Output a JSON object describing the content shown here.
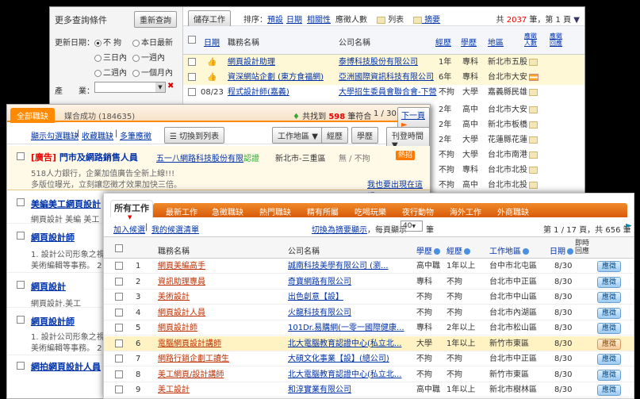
{
  "w1": {
    "side_title": "更多查詢條件",
    "reset": "重新查詢",
    "update_label": "更新日期：",
    "dates": [
      "不 拘",
      "本日最新",
      "三日內",
      "一週內",
      "二週內",
      "一個月內"
    ],
    "industry_label": "產　　業：",
    "save": "儲存工作",
    "sort_label": "排序：",
    "sorts": [
      "預設",
      "日期",
      "相關性"
    ],
    "applicants": "應徵人數",
    "view_list": "列表",
    "view_summary": "摘要",
    "total_prefix": "共",
    "total": "2037",
    "total_mid": "筆，第",
    "page": "1",
    "page_suffix": "頁",
    "cols": [
      "日期",
      "職務名稱",
      "公司名稱",
      "經歷",
      "學歷",
      "地區",
      "應徵人數",
      "應徵回應"
    ],
    "rows": [
      {
        "date": "",
        "job": "網頁設計助理",
        "company": "泰博科技股份有限公司",
        "exp": "1年",
        "edu": "專科",
        "area": "新北市五股"
      },
      {
        "date": "",
        "job": "資深網站企劃 (東方食福網)",
        "company": "亞洲國際資訊科技有限公司",
        "exp": "6年",
        "edu": "專科",
        "area": "台北市大安"
      },
      {
        "date": "08/23",
        "job": "程式設計師(嘉義)",
        "company": "大學招生委員會聯合會-下營",
        "exp": "不拘",
        "edu": "大學",
        "area": "嘉義縣民雄"
      }
    ],
    "more_rows": [
      {
        "exp": "2年",
        "edu": "高中",
        "area": "台北市大安"
      },
      {
        "exp": "2年",
        "edu": "高中",
        "area": "新北市板橋"
      },
      {
        "exp": "2年",
        "edu": "大學",
        "area": "花蓮縣花蓮"
      },
      {
        "exp": "不拘",
        "edu": "大學",
        "area": "台北市南港"
      },
      {
        "exp": "不拘",
        "edu": "專科",
        "area": "台北市北投"
      },
      {
        "exp": "不拘",
        "edu": "高中",
        "area": "台北市北投"
      }
    ]
  },
  "w2": {
    "tab_all": "全部職缺",
    "tab_match": "媒合成功 (184635)",
    "found_prefix": "共找到",
    "found": "598",
    "found_suffix": "筆符合",
    "page": "1 / 30",
    "next": "下一頁",
    "links": [
      "顯示勾選職缺",
      "收藏職缺",
      "多筆應徵"
    ],
    "toggle": "切換到列表",
    "filters": [
      "工作地區",
      "經歷",
      "學歷",
      "刊登時間"
    ],
    "ad_tag": "[廣告]",
    "ad_title": "門市及網路銷售人員",
    "ad_company": "五一八網路科技股份有限",
    "ad_cert": "認證",
    "ad_area": "新北市-三重區",
    "ad_salary": "無 / 不拘",
    "hot": "熱招",
    "ad_desc1": "518人力銀行，企業加值廣告全新上線!!!",
    "ad_desc2": "多版位曝光，立刻讓您徵才效果加快三倍。",
    "ad_link": "我也要出現在這裡»",
    "items": [
      {
        "title": "美編美工網頁設計",
        "desc": "網頁設計 美編 美工"
      },
      {
        "title": "網頁設計師",
        "desc": "1. 設計公司形象之視",
        "desc2": "美術編輯等事務。 2"
      },
      {
        "title": "網頁設計",
        "desc": "網頁設計.美工"
      },
      {
        "title": "網頁設計師",
        "desc": "1. 設計公司形象之視",
        "desc2": "美術編輯等事務。 2"
      },
      {
        "title": "網拍網頁設計人員",
        "desc": ""
      }
    ]
  },
  "w3": {
    "tabs": [
      "所有工作",
      "最新工作",
      "急徵職缺",
      "熱門職缺",
      "精有所屬",
      "吃喝玩樂",
      "夜行動物",
      "海外工作",
      "外商職缺"
    ],
    "add_list": "加入候選",
    "my_list": "我的候選清單",
    "switch_summary": "切換為摘要顯示",
    "per_page_label": "每頁顯示",
    "per_page": "40",
    "per_page_suffix": "筆",
    "pager": "第 1 / 17 頁，共 656 筆",
    "cols": [
      "職務名稱",
      "公司名稱",
      "學歷",
      "經歷",
      "工作地區",
      "日期",
      "即時回應"
    ],
    "rows": [
      {
        "n": "1",
        "job": "網頁美編高手",
        "company": "誠南科技美學有限公司 (瀏...",
        "edu": "高中職",
        "exp": "1年以上",
        "area": "台中市北屯區",
        "date": "8/30",
        "apply": "應徵",
        "hl": false
      },
      {
        "n": "2",
        "job": "資訊助理專員",
        "company": "奇寶網路有限公司",
        "edu": "專科",
        "exp": "不拘",
        "area": "台北市中正區",
        "date": "8/30",
        "apply": "應徵",
        "hl": false
      },
      {
        "n": "3",
        "job": "美術設計",
        "company": "出色創意【設】",
        "edu": "不拘",
        "exp": "不拘",
        "area": "台北市中山區",
        "date": "8/30",
        "apply": "應徵",
        "hl": false
      },
      {
        "n": "4",
        "job": "網頁設計人員",
        "company": "火龍科技有限公司",
        "edu": "不拘",
        "exp": "不拘",
        "area": "台北市內湖區",
        "date": "8/30",
        "apply": "應徵",
        "hl": false
      },
      {
        "n": "5",
        "job": "網頁設計師",
        "company": "101Dr.易購網(一零一國際健康...",
        "edu": "專科",
        "exp": "2年以上",
        "area": "台北市松山區",
        "date": "8/30",
        "apply": "應徵",
        "hl": false
      },
      {
        "n": "6",
        "job": "電腦網頁設計講師",
        "company": "北大電腦教育認證中心(私立北...",
        "edu": "大學",
        "exp": "1年以上",
        "area": "新竹市東區",
        "date": "8/30",
        "apply": "應徵",
        "hl": true
      },
      {
        "n": "7",
        "job": "網路行銷企劃工讀生",
        "company": "大碩文化事業【設】(總公司)",
        "edu": "不拘",
        "exp": "不拘",
        "area": "台北市中正區",
        "date": "8/30",
        "apply": "應徵",
        "hl": false
      },
      {
        "n": "8",
        "job": "美工網頁/設計講師",
        "company": "北大電腦教育認證中心(私立北...",
        "edu": "不拘",
        "exp": "不拘",
        "area": "新竹市東區",
        "date": "8/30",
        "apply": "應徵",
        "hl": false
      },
      {
        "n": "9",
        "job": "美工設計",
        "company": "和淳實業有限公司",
        "edu": "高中職",
        "exp": "1年以上",
        "area": "新北市樹林區",
        "date": "8/30",
        "apply": "應徵",
        "hl": false
      }
    ]
  },
  "colors": {
    "orange": "#ff7a00",
    "tabbar": "#e86b12",
    "highlight": "#fff3c4",
    "blue_link": "#0033aa"
  }
}
